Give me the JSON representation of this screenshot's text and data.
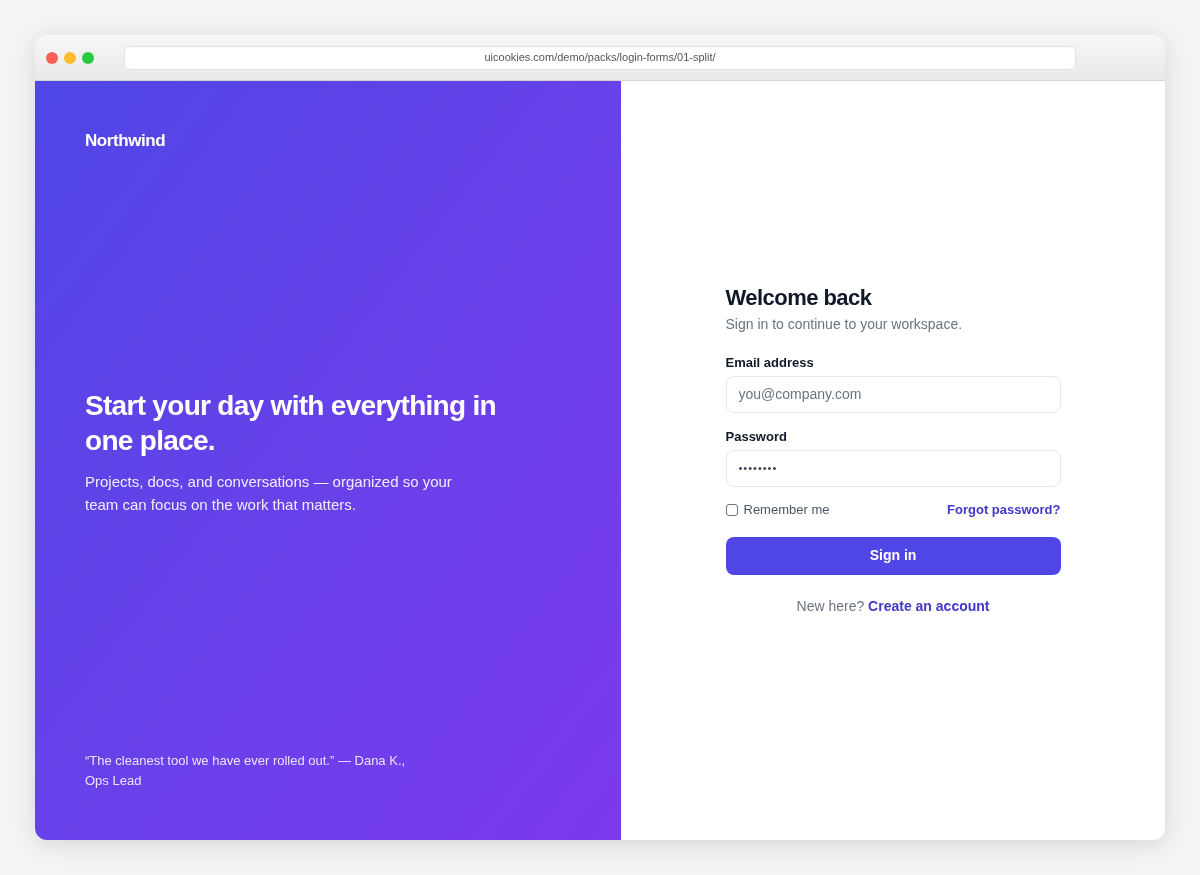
{
  "browser": {
    "url": "uicookies.com/demo/packs/login-forms/01-split/"
  },
  "brand_panel": {
    "logo": "Northwind",
    "headline": "Start your day with everything in one place.",
    "description": "Projects, docs, and conversations — organized so your team can focus on the work that matters.",
    "testimonial": "“The cleanest tool we have ever rolled out.” — Dana K., Ops Lead"
  },
  "login_form": {
    "title": "Welcome back",
    "subtitle": "Sign in to continue to your workspace.",
    "fields": [
      {
        "label": "Email address",
        "placeholder": "you@company.com"
      },
      {
        "label": "Password",
        "value": "••••••••"
      }
    ],
    "remember_me": {
      "label": "Remember me",
      "checked": false
    },
    "forgot_link": "Forgot password?",
    "submit_button": "Sign in",
    "signup_prompt": "New here?",
    "signup_link": "Create an account"
  }
}
